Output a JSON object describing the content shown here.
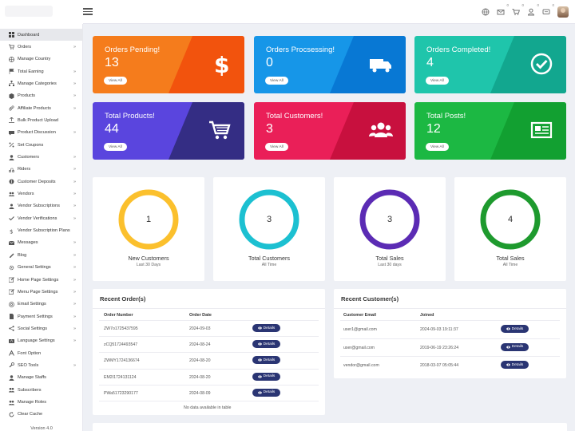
{
  "sidebar": {
    "items": [
      {
        "label": "Dashboard",
        "icon": "dashboard-icon",
        "arrow": false,
        "active": true
      },
      {
        "label": "Orders",
        "icon": "cart-icon",
        "arrow": true
      },
      {
        "label": "Manage Country",
        "icon": "globe-icon",
        "arrow": false
      },
      {
        "label": "Total Earning",
        "icon": "flag-icon",
        "arrow": true
      },
      {
        "label": "Manage Categories",
        "icon": "sitemap-icon",
        "arrow": true
      },
      {
        "label": "Products",
        "icon": "box-icon",
        "arrow": true
      },
      {
        "label": "Affiliate Products",
        "icon": "link-icon",
        "arrow": true
      },
      {
        "label": "Bulk Product Upload",
        "icon": "upload-icon",
        "arrow": false
      },
      {
        "label": "Product Discussion",
        "icon": "comment-icon",
        "arrow": true
      },
      {
        "label": "Set Coupons",
        "icon": "percent-icon",
        "arrow": false
      },
      {
        "label": "Customers",
        "icon": "user-icon",
        "arrow": true
      },
      {
        "label": "Riders",
        "icon": "rider-icon",
        "arrow": true
      },
      {
        "label": "Customer Deposits",
        "icon": "deposit-icon",
        "arrow": true
      },
      {
        "label": "Vendors",
        "icon": "vendors-icon",
        "arrow": true
      },
      {
        "label": "Vendor Subscriptions",
        "icon": "subscription-icon",
        "arrow": true
      },
      {
        "label": "Vendor Verifications",
        "icon": "check-icon",
        "arrow": true
      },
      {
        "label": "Vendor Subscription Plans",
        "icon": "dollar-icon",
        "arrow": false
      },
      {
        "label": "Messages",
        "icon": "envelope-icon",
        "arrow": true
      },
      {
        "label": "Blog",
        "icon": "blog-icon",
        "arrow": true
      },
      {
        "label": "General Settings",
        "icon": "cogs-icon",
        "arrow": true
      },
      {
        "label": "Home Page Settings",
        "icon": "edit-icon",
        "arrow": true
      },
      {
        "label": "Menu Page Settings",
        "icon": "menu-edit-icon",
        "arrow": true
      },
      {
        "label": "Email Settings",
        "icon": "at-icon",
        "arrow": true
      },
      {
        "label": "Payment Settings",
        "icon": "file-icon",
        "arrow": true
      },
      {
        "label": "Social Settings",
        "icon": "share-icon",
        "arrow": true
      },
      {
        "label": "Language Settings",
        "icon": "language-icon",
        "arrow": true
      },
      {
        "label": "Font Option",
        "icon": "font-icon",
        "arrow": false
      },
      {
        "label": "SEO Tools",
        "icon": "wrench-icon",
        "arrow": true
      },
      {
        "label": "Manage Staffs",
        "icon": "staff-icon",
        "arrow": false
      },
      {
        "label": "Subscribers",
        "icon": "group-icon",
        "arrow": false
      },
      {
        "label": "Manage Roles",
        "icon": "roles-icon",
        "arrow": false
      },
      {
        "label": "Clear Cache",
        "icon": "refresh-icon",
        "arrow": false
      }
    ],
    "arrow_glyph": "»",
    "version": "Version 4.0"
  },
  "topbar": {
    "badges": {
      "mail": "0",
      "cart": "0",
      "user": "0",
      "chat": "0"
    }
  },
  "stat_cards": [
    {
      "title": "Orders Pending!",
      "value": "13",
      "button": "View All",
      "icon": "dollar-icon",
      "color_a": "#f57c1c",
      "color_b": "#f2530d"
    },
    {
      "title": "Orders Procsessing!",
      "value": "0",
      "button": "View All",
      "icon": "truck-icon",
      "color_a": "#1696e8",
      "color_b": "#0878d4"
    },
    {
      "title": "Orders Completed!",
      "value": "4",
      "button": "View All",
      "icon": "check-circle-icon",
      "color_a": "#1fc5ab",
      "color_b": "#12a78f"
    },
    {
      "title": "Total Products!",
      "value": "44",
      "button": "View All",
      "icon": "cart-icon",
      "color_a": "#5a45de",
      "color_b": "#342d84"
    },
    {
      "title": "Total Customers!",
      "value": "3",
      "button": "View All",
      "icon": "users-icon",
      "color_a": "#ea1f58",
      "color_b": "#c8103e"
    },
    {
      "title": "Total Posts!",
      "value": "12",
      "button": "View All",
      "icon": "newspaper-icon",
      "color_a": "#1cb843",
      "color_b": "#12a031"
    }
  ],
  "ring_cards": [
    {
      "value": "1",
      "label": "New Customers",
      "sub": "Last 30 Days",
      "color": "#fbc02d"
    },
    {
      "value": "3",
      "label": "Total Customers",
      "sub": "All Time",
      "color": "#1cc0d1"
    },
    {
      "value": "3",
      "label": "Total Sales",
      "sub": "Last 30 days",
      "color": "#5b2bb4"
    },
    {
      "value": "4",
      "label": "Total Sales",
      "sub": "All Time",
      "color": "#1e9a2e"
    }
  ],
  "recent_orders": {
    "title": "Recent Order(s)",
    "headers": [
      "Order Number",
      "Order Date"
    ],
    "rows": [
      {
        "number": "ZW7o1725437595",
        "date": "2024-09-03"
      },
      {
        "number": "zCQ51724493547",
        "date": "2024-08-24"
      },
      {
        "number": "ZWMY1724136674",
        "date": "2024-08-20"
      },
      {
        "number": "EM2I1724131124",
        "date": "2024-08-20"
      },
      {
        "number": "PWa51723290177",
        "date": "2024-08-09"
      }
    ],
    "button": "Details",
    "empty_text": "No data available in table"
  },
  "recent_customers": {
    "title": "Recent Customer(s)",
    "headers": [
      "Customer Email",
      "Joined"
    ],
    "rows": [
      {
        "email": "user1@gmail.com",
        "joined": "2024-09-03 19:11:37"
      },
      {
        "email": "user@gmail.com",
        "joined": "2019-06-19 23:26:24"
      },
      {
        "email": "vendor@gmail.com",
        "joined": "2018-03-07 05:05:44"
      }
    ],
    "button": "Details"
  }
}
